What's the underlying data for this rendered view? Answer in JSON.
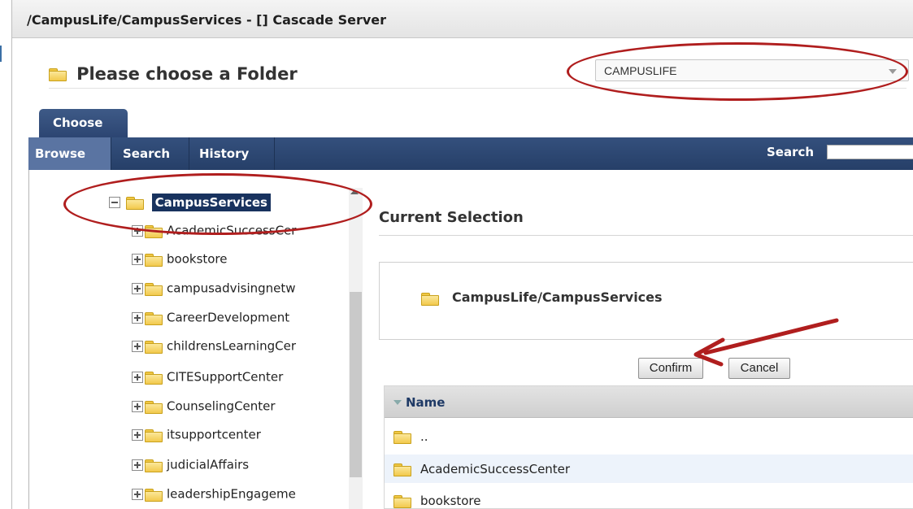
{
  "window": {
    "title": "/CampusLife/CampusServices - [] Cascade Server"
  },
  "header": {
    "title": "Please choose a Folder"
  },
  "site_select": {
    "value": "CAMPUSLIFE"
  },
  "tabs": {
    "choose": "Choose"
  },
  "nav": {
    "browse": "Browse",
    "search": "Search",
    "history": "History",
    "search_label": "Search"
  },
  "tree": {
    "root": "CampusServices",
    "items": [
      "AcademicSuccessCer",
      "bookstore",
      "campusadvisingnetw",
      "CareerDevelopment",
      "childrensLearningCer",
      "CITESupportCenter",
      "CounselingCenter",
      "itsupportcenter",
      "judicialAffairs",
      "leadershipEngageme"
    ]
  },
  "selection": {
    "heading": "Current Selection",
    "path": "CampusLife/CampusServices"
  },
  "buttons": {
    "confirm": "Confirm",
    "cancel": "Cancel"
  },
  "table": {
    "header": "Name",
    "rows": [
      "..",
      "AcademicSuccessCenter",
      "bookstore"
    ]
  },
  "annotation_color": "#b01e1e"
}
